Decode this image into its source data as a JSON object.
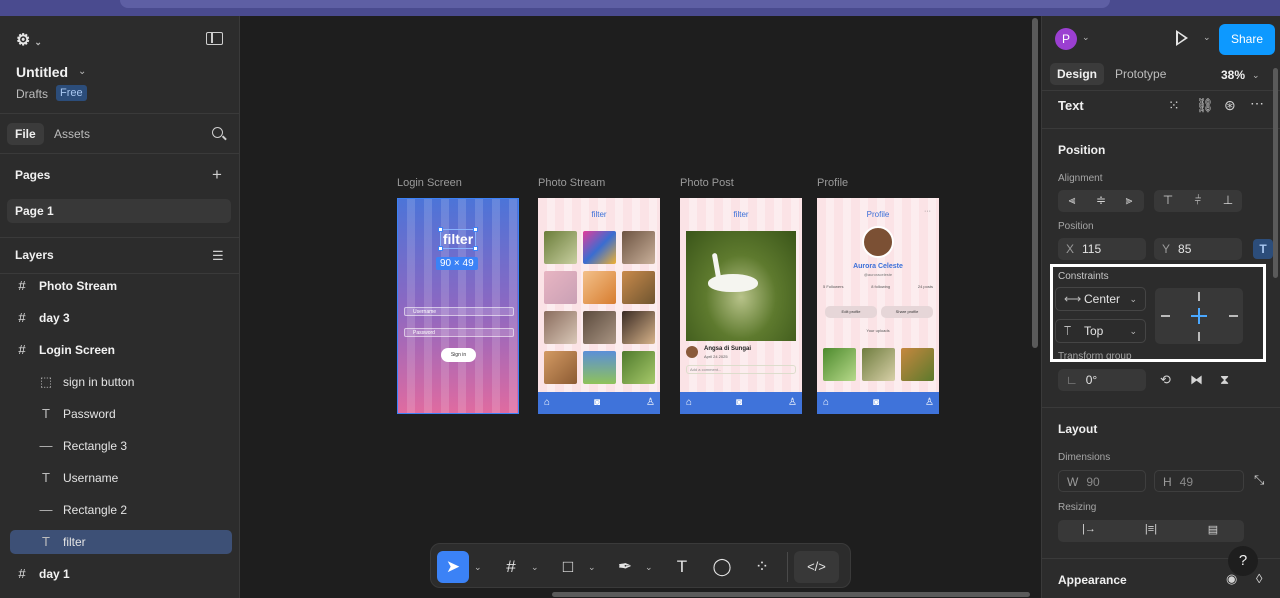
{
  "file": {
    "title": "Untitled",
    "location": "Drafts",
    "plan_badge": "Free"
  },
  "left_tabs": {
    "file": "File",
    "assets": "Assets"
  },
  "pages": {
    "heading": "Pages",
    "items": [
      "Page 1"
    ]
  },
  "layers": {
    "heading": "Layers",
    "items": [
      {
        "label": "Photo Stream",
        "icon": "frame-icon",
        "glyph": "#",
        "level": 0
      },
      {
        "label": "day 3",
        "icon": "frame-icon",
        "glyph": "#",
        "level": 0
      },
      {
        "label": "Login Screen",
        "icon": "frame-icon",
        "glyph": "#",
        "level": 0
      },
      {
        "label": "sign in button",
        "icon": "group-icon",
        "glyph": "⬚",
        "level": 1
      },
      {
        "label": "Password",
        "icon": "text-icon",
        "glyph": "T",
        "level": 1
      },
      {
        "label": "Rectangle 3",
        "icon": "line-icon",
        "glyph": "—",
        "level": 1
      },
      {
        "label": "Username",
        "icon": "text-icon",
        "glyph": "T",
        "level": 1
      },
      {
        "label": "Rectangle 2",
        "icon": "line-icon",
        "glyph": "—",
        "level": 1
      },
      {
        "label": "filter",
        "icon": "text-icon",
        "glyph": "T",
        "level": 1,
        "selected": true
      },
      {
        "label": "day 1",
        "icon": "frame-icon",
        "glyph": "#",
        "level": 0
      }
    ]
  },
  "canvas": {
    "frames": [
      {
        "label": "Login Screen"
      },
      {
        "label": "Photo Stream"
      },
      {
        "label": "Photo Post"
      },
      {
        "label": "Profile"
      }
    ],
    "login": {
      "logo_text": "filter",
      "dimension_badge": "90 × 49",
      "username_placeholder": "Username",
      "password_placeholder": "Password",
      "sign_in": "Sign in"
    },
    "stream": {
      "title": "filter"
    },
    "post": {
      "title": "filter",
      "author": "Angsa di Sungai",
      "date": "April 24 2025",
      "comment_placeholder": "Add a comment..."
    },
    "profile": {
      "title": "Profile",
      "name": "Aurora Celeste",
      "handle": "@auroraceleste",
      "stats": [
        "5 Followers",
        "8 following",
        "24 posts"
      ],
      "edit_button": "Edit profile",
      "share_button": "Share profile",
      "uploads_label": "Your uploads"
    }
  },
  "toolbar": {
    "tools": [
      "move-tool",
      "frame-tool",
      "shape-tool",
      "pen-tool",
      "text-tool",
      "comment-tool",
      "actions-tool",
      "dev-mode-toggle"
    ]
  },
  "right_panel": {
    "user_initial": "P",
    "share_label": "Share",
    "tabs": {
      "design": "Design",
      "prototype": "Prototype"
    },
    "zoom": "38%",
    "selection_type": "Text",
    "position": {
      "heading": "Position",
      "alignment_label": "Alignment",
      "position_label": "Position",
      "x_label": "X",
      "x_value": "115",
      "y_label": "Y",
      "y_value": "85"
    },
    "constraints": {
      "label": "Constraints",
      "horizontal": "Center",
      "vertical": "Top",
      "transform_group_label": "Transform group",
      "rotation": "0°"
    },
    "layout": {
      "heading": "Layout",
      "dimensions_label": "Dimensions",
      "w_label": "W",
      "w_value": "90",
      "h_label": "H",
      "h_value": "49",
      "resizing_label": "Resizing"
    },
    "appearance": {
      "heading": "Appearance"
    }
  },
  "colors": {
    "accent": "#0d99ff",
    "selection_blue": "#3b82f6",
    "panel_bg": "#2c2c2c",
    "canvas_bg": "#1e1e1e"
  }
}
